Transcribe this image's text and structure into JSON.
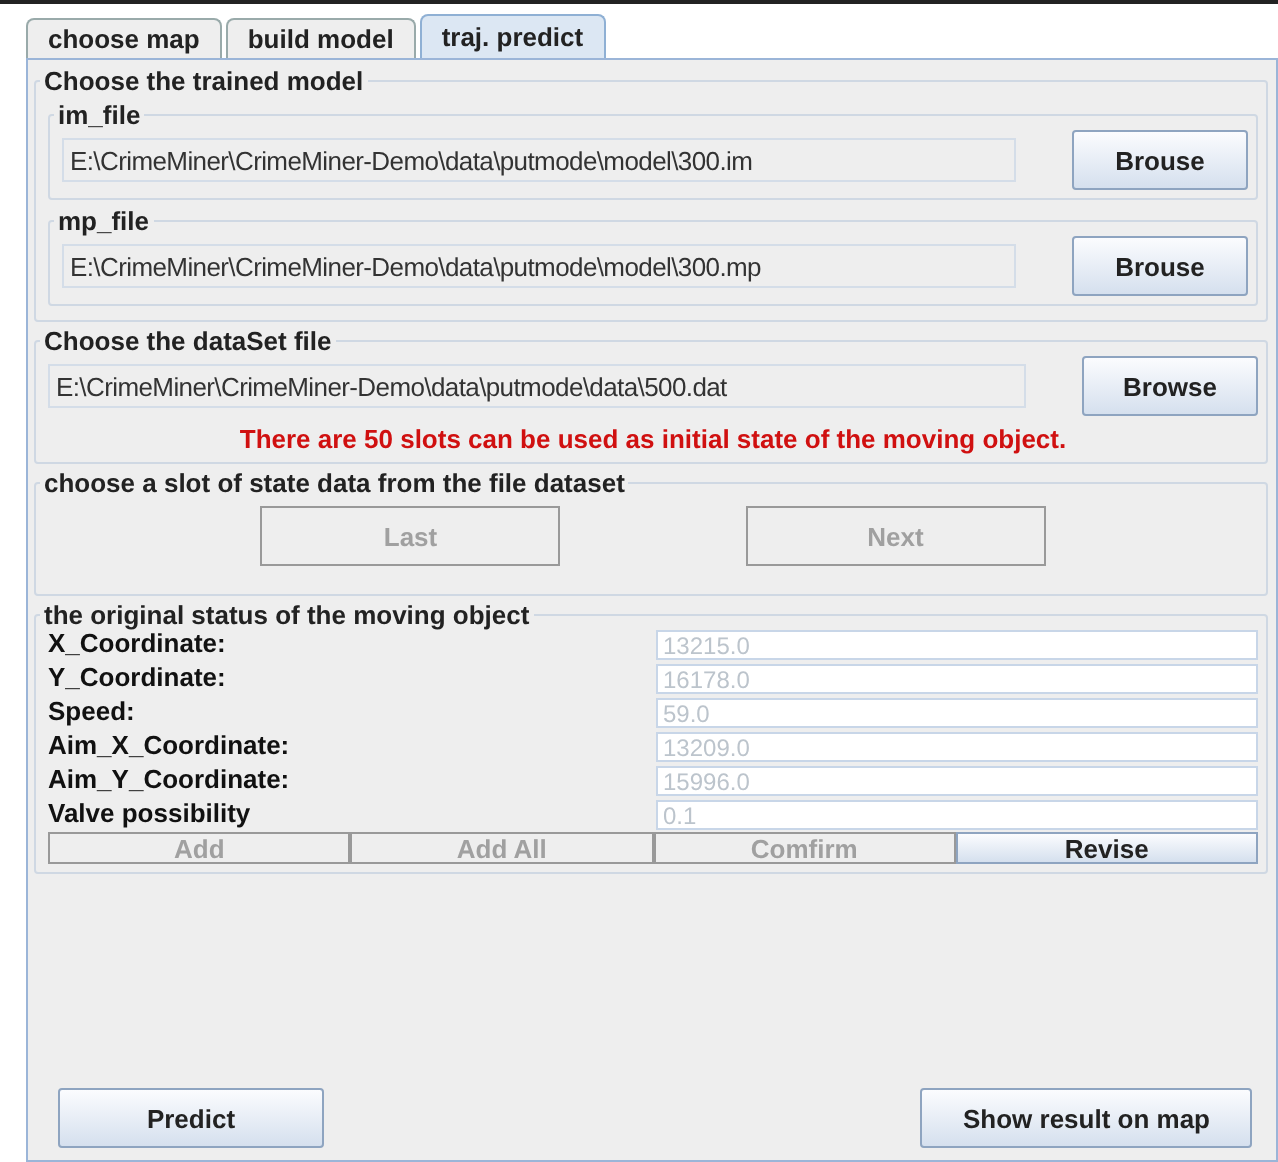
{
  "tabs": [
    {
      "label": "choose map",
      "selected": false
    },
    {
      "label": "build model",
      "selected": false
    },
    {
      "label": "traj. predict",
      "selected": true
    }
  ],
  "model_group": {
    "title": "Choose the trained model",
    "files": [
      {
        "title": "im_file",
        "value": "E:\\CrimeMiner\\CrimeMiner-Demo\\data\\putmode\\model\\300.im",
        "button": "Brouse"
      },
      {
        "title": "mp_file",
        "value": "E:\\CrimeMiner\\CrimeMiner-Demo\\data\\putmode\\model\\300.mp",
        "button": "Brouse"
      }
    ]
  },
  "dataset_group": {
    "title": "Choose the dataSet file",
    "value": "E:\\CrimeMiner\\CrimeMiner-Demo\\data\\putmode\\data\\500.dat",
    "button": "Browse",
    "message": "There are 50 slots can be used as initial state of the moving object."
  },
  "slot_group": {
    "title": "choose a slot of state data from the file dataset",
    "buttons": [
      {
        "label": "Last",
        "disabled": true
      },
      {
        "label": "Next",
        "disabled": true
      }
    ]
  },
  "status_group": {
    "title": "the original status of the moving object",
    "fields": [
      {
        "label": "X_Coordinate:",
        "value": "13215.0",
        "disabled": true
      },
      {
        "label": "Y_Coordinate:",
        "value": "16178.0",
        "disabled": true
      },
      {
        "label": "Speed:",
        "value": "59.0",
        "disabled": true
      },
      {
        "label": "Aim_X_Coordinate:",
        "value": "13209.0",
        "disabled": true
      },
      {
        "label": "Aim_Y_Coordinate:",
        "value": "15996.0",
        "disabled": true
      },
      {
        "label": "Valve possibility",
        "value": "0.1",
        "disabled": true
      }
    ],
    "buttons": [
      {
        "label": "Add",
        "disabled": true
      },
      {
        "label": "Add All",
        "disabled": true
      },
      {
        "label": "Comfirm",
        "disabled": true
      },
      {
        "label": "Revise",
        "disabled": false
      }
    ]
  },
  "bottom_buttons": [
    {
      "label": "Predict"
    },
    {
      "label": "Show result on map"
    }
  ]
}
